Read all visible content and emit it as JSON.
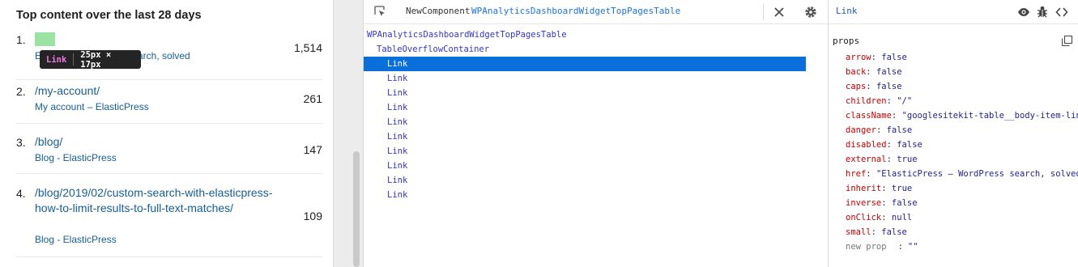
{
  "widget": {
    "title": "Top content over the last 28 days",
    "rows": [
      {
        "num": "1.",
        "path": "/",
        "subtitle": "ElasticPress – WordPress search, solved",
        "count": "1,514"
      },
      {
        "num": "2.",
        "path": "/my-account/",
        "subtitle": "My account – ElasticPress",
        "count": "261"
      },
      {
        "num": "3.",
        "path": "/blog/",
        "subtitle": "Blog - ElasticPress",
        "count": "147"
      },
      {
        "num": "4.",
        "path": "/blog/2019/02/custom-search-with-elasticpress-how-to-limit-results-to-full-text-matches/",
        "subtitle": "Blog - ElasticPress",
        "count": "109"
      }
    ],
    "row1_visible_subtitle_start": "E",
    "row1_visible_subtitle_end": "ss search, solved",
    "highlight_color": "#9be3a3",
    "tooltip": {
      "name": "Link",
      "size": "25px × 17px"
    }
  },
  "tree": {
    "breadcrumb_parent": "NewComponent",
    "breadcrumb_current": "WPAnalyticsDashboardWidgetTopPagesTable",
    "root": "WPAnalyticsDashboardWidgetTopPagesTable",
    "child": "TableOverflowContainer",
    "leaves": [
      "Link",
      "Link",
      "Link",
      "Link",
      "Link",
      "Link",
      "Link",
      "Link",
      "Link",
      "Link"
    ],
    "selected_index": 0,
    "selection_color": "#0a6edb"
  },
  "props": {
    "component": "Link",
    "header": "props",
    "items": [
      {
        "key": "arrow",
        "value": "false"
      },
      {
        "key": "back",
        "value": "false"
      },
      {
        "key": "caps",
        "value": "false"
      },
      {
        "key": "children",
        "value": "\"/\""
      },
      {
        "key": "className",
        "value": "\"googlesitekit-table__body-item-lin"
      },
      {
        "key": "danger",
        "value": "false"
      },
      {
        "key": "disabled",
        "value": "false"
      },
      {
        "key": "external",
        "value": "true"
      },
      {
        "key": "href",
        "value": "\"ElasticPress – WordPress search, solved"
      },
      {
        "key": "inherit",
        "value": "true"
      },
      {
        "key": "inverse",
        "value": "false"
      },
      {
        "key": "onClick",
        "value": "null"
      },
      {
        "key": "small",
        "value": "false"
      }
    ],
    "new_prop": {
      "key": "new prop",
      "colon": ":",
      "value": "\"\""
    }
  },
  "colors": {
    "link": "#135e96",
    "prop_key": "#c80000",
    "tree_node": "#3535c8"
  }
}
